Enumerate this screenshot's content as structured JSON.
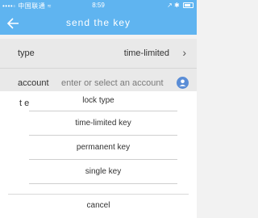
{
  "status_bar": {
    "signal": "••••◦ 中国联通 ≈",
    "time": "8:59",
    "right": "↗ ✱"
  },
  "nav": {
    "title": "send the key",
    "back_icon": "back-arrow-icon"
  },
  "form": {
    "type_label": "type",
    "type_value": "time-limited",
    "account_label": "account",
    "account_placeholder": "enter or select an account"
  },
  "sheet": {
    "left_label": "t  e",
    "title": "lock type",
    "options": [
      "time-limited key",
      "permanent key",
      "single key"
    ],
    "cancel": "cancel"
  },
  "colors": {
    "header": "#5fb4f0",
    "accent": "#5a8dd6"
  }
}
